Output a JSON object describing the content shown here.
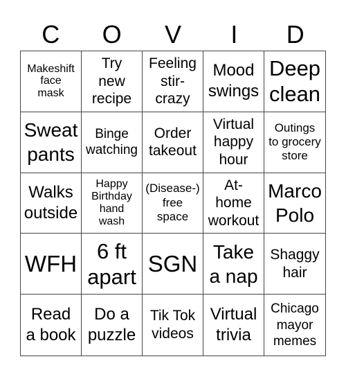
{
  "title_letters": [
    "C",
    "O",
    "V",
    "I",
    "D"
  ],
  "cells": [
    "Makeshift face mask",
    "Try new recipe",
    "Feeling stir-crazy",
    "Mood swings",
    "Deep clean",
    "Sweat pants",
    "Binge watching",
    "Order takeout",
    "Virtual happy hour",
    "Outings to grocery store",
    "Walks outside",
    "Happy Birthday hand wash",
    "(Disease-) free space",
    "At-home workout",
    "Marco Polo",
    "WFH",
    "6 ft apart",
    "SGN",
    "Take a nap",
    "Shaggy hair",
    "Read a book",
    "Do a puzzle",
    "Tik Tok videos",
    "Virtual trivia",
    "Chicago mayor memes"
  ],
  "cell_lines": [
    [
      "Makeshift",
      "face",
      "mask"
    ],
    [
      "Try",
      "new",
      "recipe"
    ],
    [
      "Feeling",
      "stir-",
      "crazy"
    ],
    [
      "Mood",
      "swings"
    ],
    [
      "Deep",
      "clean"
    ],
    [
      "Sweat",
      "pants"
    ],
    [
      "Binge",
      "watching"
    ],
    [
      "Order",
      "takeout"
    ],
    [
      "Virtual",
      "happy",
      "hour"
    ],
    [
      "Outings",
      "to grocery",
      "store"
    ],
    [
      "Walks",
      "outside"
    ],
    [
      "Happy",
      "Birthday",
      "hand",
      "wash"
    ],
    [
      "(Disease-)",
      "free",
      "space"
    ],
    [
      "At-",
      "home",
      "workout"
    ],
    [
      "Marco",
      "Polo"
    ],
    [
      "WFH"
    ],
    [
      "6 ft",
      "apart"
    ],
    [
      "SGN"
    ],
    [
      "Take",
      "a nap"
    ],
    [
      "Shaggy",
      "hair"
    ],
    [
      "Read",
      "a book"
    ],
    [
      "Do a",
      "puzzle"
    ],
    [
      "Tik Tok",
      "videos"
    ],
    [
      "Virtual",
      "trivia"
    ],
    [
      "Chicago",
      "mayor",
      "memes"
    ]
  ],
  "colors": {
    "background": "#ffffff",
    "grid_line": "#444444",
    "text": "#000000"
  }
}
